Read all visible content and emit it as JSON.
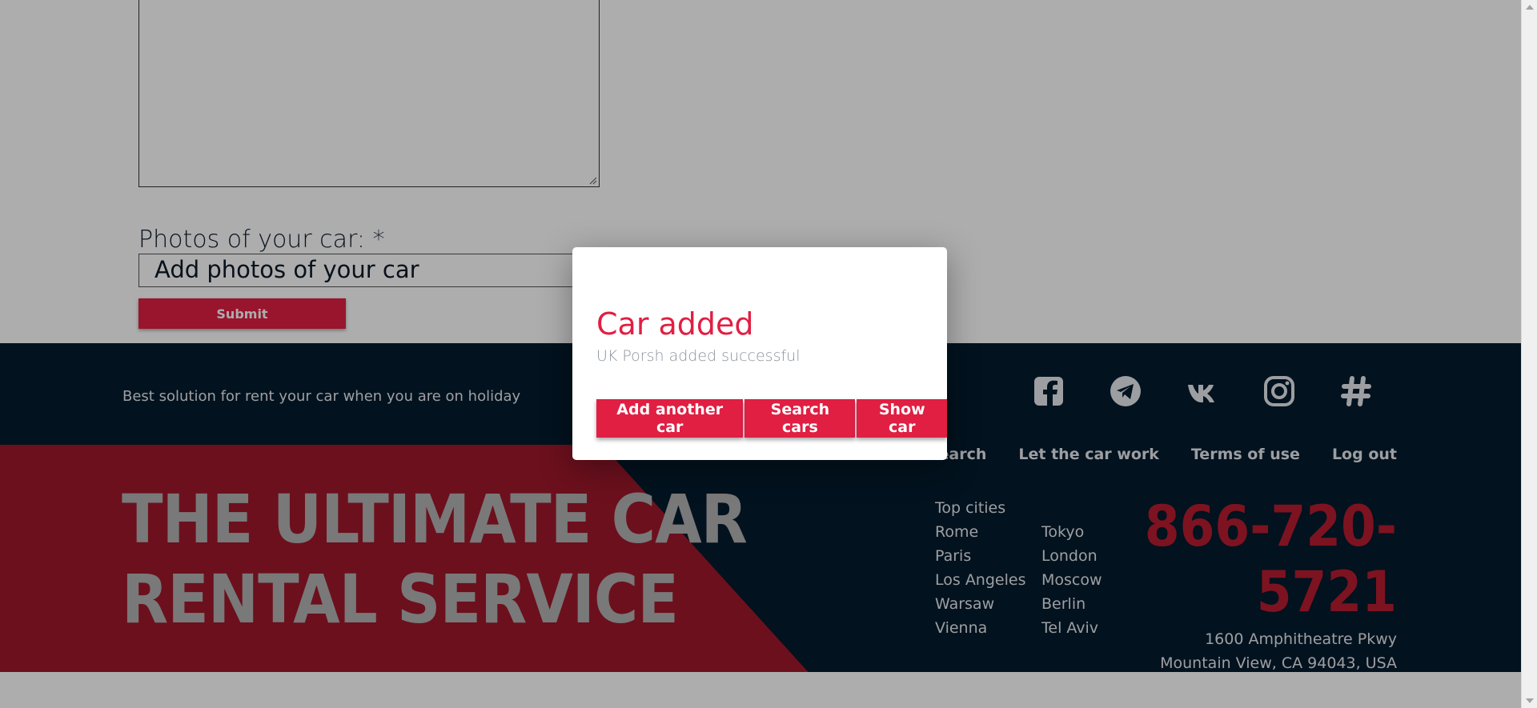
{
  "form": {
    "photos_label": "Photos of your car: *",
    "photos_placeholder": "Add photos of your car",
    "submit_label": "Submit"
  },
  "footer": {
    "tagline": "Best solution for rent your car when you are on holiday",
    "socials": [
      "facebook-icon",
      "telegram-icon",
      "vk-icon",
      "instagram-icon",
      "hashtag-icon"
    ],
    "nav": [
      {
        "label": "Search"
      },
      {
        "label": "Let the car work"
      },
      {
        "label": "Terms of use"
      },
      {
        "label": "Log out"
      }
    ],
    "headline_line1": "THE ULTIMATE CAR",
    "headline_line2": "RENTAL SERVICE",
    "top_cities_title": "Top cities",
    "cities": [
      "Rome",
      "Tokyo",
      "Paris",
      "London",
      "Los Angeles",
      "Moscow",
      "Warsaw",
      "Berlin",
      "Vienna",
      "Tel Aviv"
    ],
    "phone_line1": "866-720-",
    "phone_line2": "5721",
    "address_line1": "1600 Amphitheatre Pkwy",
    "address_line2": "Mountain View, CA 94043, USA"
  },
  "modal": {
    "title": "Car added",
    "message": "UK Porsh added successful",
    "buttons": [
      "Add another car",
      "Search cars",
      "Show car"
    ]
  },
  "colors": {
    "accent": "#e01f43",
    "footer_bg": "#041b2d",
    "stripe_red": "#a0182b",
    "headline": "#b3b3b3"
  }
}
